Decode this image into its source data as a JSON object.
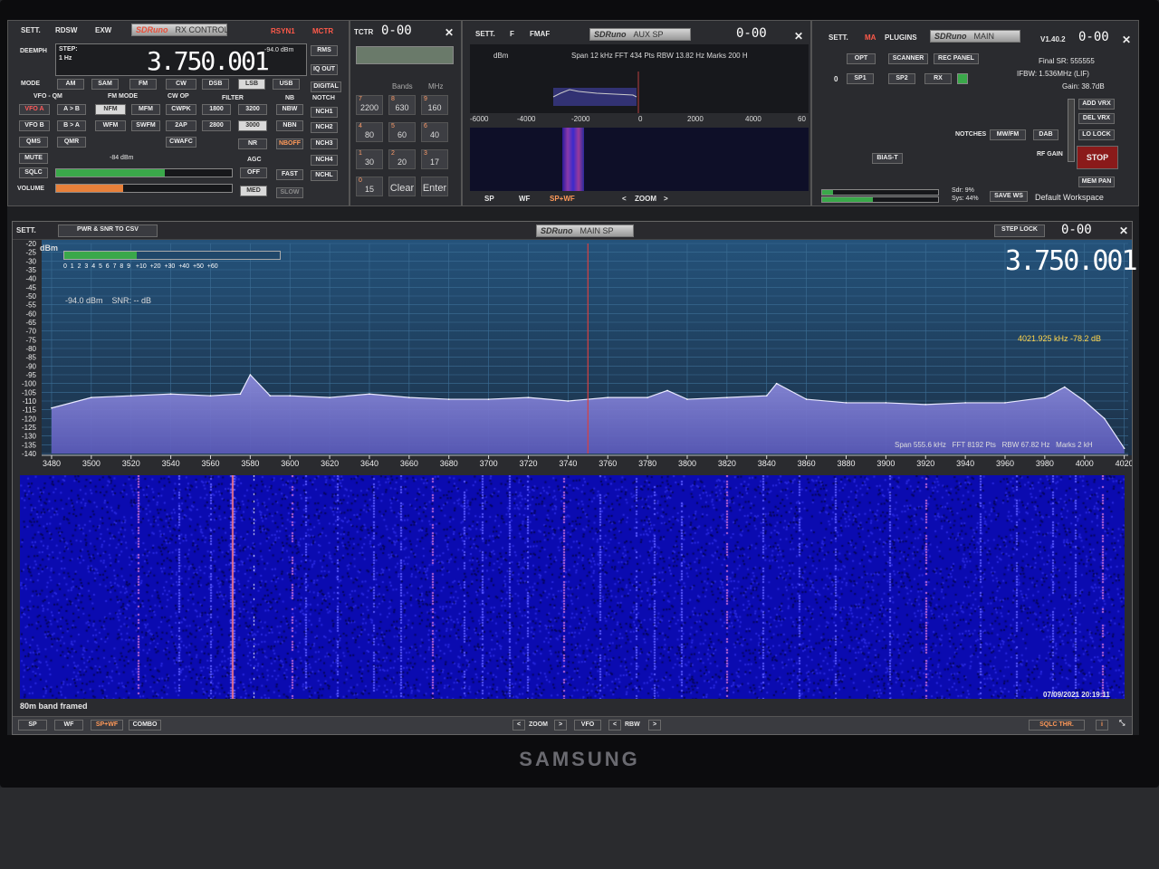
{
  "rx_control": {
    "sett": "SETT.",
    "rdsw": "RDSW",
    "exw": "EXW",
    "logo": "SDRuno",
    "subtitle": "RX CONTROL",
    "rsyn1": "RSYN1",
    "mctr": "MCTR",
    "deemph": "DEEMPH",
    "step_label": "STEP:",
    "step_value": "1 Hz",
    "frequency": "3.750.001",
    "dbm": "-94.0 dBm",
    "right_buttons": [
      "RMS",
      "IQ OUT",
      "DIGITAL"
    ],
    "mode_label": "MODE",
    "modes": [
      "AM",
      "SAM",
      "FM",
      "CW",
      "DSB",
      "LSB",
      "USB"
    ],
    "vfo_qm": "VFO - QM",
    "fm_mode": "FM MODE",
    "cw_op": "CW OP",
    "filter": "FILTER",
    "nb": "NB",
    "notch": "NOTCH",
    "vfo_a": "VFO A",
    "a_to_b": "A > B",
    "nfm": "NFM",
    "mfm": "MFM",
    "cwpk": "CWPK",
    "f1800": "1800",
    "f3200": "3200",
    "nbw": "NBW",
    "nch1": "NCH1",
    "vfo_b": "VFO B",
    "b_to_a": "B > A",
    "wfm": "WFM",
    "swfm": "SWFM",
    "twoap": "2AP",
    "f2800": "2800",
    "f3000": "3000",
    "nbn": "NBN",
    "nch2": "NCH2",
    "qms": "QMS",
    "qmr": "QMR",
    "cwafc": "CWAFC",
    "nr": "NR",
    "nboff": "NBOFF",
    "nch3": "NCH3",
    "nch4": "NCH4",
    "nchl": "NCHL",
    "mute": "MUTE",
    "sqlc": "SQLC",
    "volume": "VOLUME",
    "squelch_dbm": "-84 dBm",
    "agc": "AGC",
    "agc_off": "OFF",
    "agc_fast": "FAST",
    "agc_med": "MED",
    "agc_slow": "SLOW",
    "squelch_level": 0.62,
    "volume_level": 0.38
  },
  "tctr": {
    "label": "TCTR",
    "display": "0-00",
    "bands": "Bands",
    "mhz": "MHz",
    "keys": [
      {
        "n": "7",
        "v": "2200"
      },
      {
        "n": "8",
        "v": "630"
      },
      {
        "n": "9",
        "v": "160"
      },
      {
        "n": "4",
        "v": "80"
      },
      {
        "n": "5",
        "v": "60"
      },
      {
        "n": "6",
        "v": "40"
      },
      {
        "n": "1",
        "v": "30"
      },
      {
        "n": "2",
        "v": "20"
      },
      {
        "n": "3",
        "v": "17"
      },
      {
        "n": "0",
        "v": "15"
      }
    ],
    "clear": "Clear",
    "enter": "Enter"
  },
  "aux_sp": {
    "sett": "SETT.",
    "f": "F",
    "fmaf": "FMAF",
    "logo": "SDRuno",
    "subtitle": "AUX SP",
    "display": "0-00",
    "dbm": "dBm",
    "info": "Span 12 kHz  FFT 434 Pts  RBW 13.82 Hz  Marks 200 H",
    "ticks": [
      "-6000",
      "-4000",
      "-2000",
      "0",
      "2000",
      "4000",
      "60"
    ],
    "sp": "SP",
    "wf": "WF",
    "spwf": "SP+WF",
    "zoom": "ZOOM"
  },
  "main": {
    "sett": "SETT.",
    "ma": "MA",
    "plugins": "PLUGINS",
    "logo": "SDRuno",
    "subtitle": "MAIN",
    "version": "V1.40.2",
    "display": "0-00",
    "opt": "OPT",
    "scanner": "SCANNER",
    "rec_panel": "REC PANEL",
    "zero": "0",
    "sp1": "SP1",
    "sp2": "SP2",
    "rx": "RX",
    "final_sr": "Final SR: 555555",
    "ifbw": "IFBW: 1.536MHz (LIF)",
    "gain": "Gain: 38.7dB",
    "add_vrx": "ADD VRX",
    "del_vrx": "DEL VRX",
    "lo_lock": "LO LOCK",
    "stop": "STOP",
    "mem_pan": "MEM PAN",
    "notches": "NOTCHES",
    "mwfm": "MW/FM",
    "dab": "DAB",
    "rf_gain": "RF GAIN",
    "bias_t": "BIAS-T",
    "sdr": "Sdr: 9%",
    "sys": "Sys: 44%",
    "save_ws": "SAVE WS",
    "workspace": "Default Workspace",
    "sdr_load": 0.09,
    "sys_load": 0.44
  },
  "main_sp": {
    "sett": "SETT.",
    "pwr_csv": "PWR & SNR TO CSV",
    "logo": "SDRuno",
    "subtitle": "MAIN SP",
    "step_lock": "STEP LOCK",
    "display": "0-00",
    "frequency": "3.750.001",
    "dbm_axis": "dBm",
    "y_ticks": [
      "-20",
      "-25",
      "-30",
      "-35",
      "-40",
      "-45",
      "-50",
      "-55",
      "-60",
      "-65",
      "-70",
      "-75",
      "-80",
      "-85",
      "-90",
      "-95",
      "-100",
      "-105",
      "-110",
      "-115",
      "-120",
      "-125",
      "-130",
      "-135",
      "-140"
    ],
    "s_scale": [
      "1",
      "2",
      "3",
      "4",
      "5",
      "6",
      "7",
      "8",
      "9",
      "+10",
      "+20",
      "+30",
      "+40",
      "+50",
      "+60"
    ],
    "s_zero": "0",
    "snr_text": "-94.0 dBm    SNR: -- dB",
    "cursor": "4021.925 kHz -78.2 dB",
    "info": "Span 555.6 kHz   FFT 8192 Pts   RBW 67.82 Hz   Marks 2 kH",
    "x_ticks": [
      "3480",
      "3500",
      "3520",
      "3540",
      "3560",
      "3580",
      "3600",
      "3620",
      "3640",
      "3660",
      "3680",
      "3700",
      "3720",
      "3740",
      "3760",
      "3780",
      "3800",
      "3820",
      "3840",
      "3860",
      "3880",
      "3900",
      "3920",
      "3940",
      "3960",
      "3980",
      "4000",
      "4020"
    ],
    "tuned_khz": 3750.001,
    "caption": "80m band framed",
    "timestamp": "07/09/2021 20:19:11",
    "sp": "SP",
    "wf": "WF",
    "spwf": "SP+WF",
    "combo": "COMBO",
    "zoom": "ZOOM",
    "vfo": "VFO",
    "rbw": "RBW",
    "sqlc_thr": "SQLC THR.",
    "i": "i"
  },
  "monitor": {
    "brand": "SAMSUNG"
  },
  "chart_data": {
    "type": "area",
    "title": "",
    "xlabel": "kHz",
    "ylabel": "dBm",
    "xlim": [
      3475,
      4022
    ],
    "ylim": [
      -140,
      -20
    ],
    "x": [
      3480,
      3500,
      3520,
      3540,
      3560,
      3575,
      3580,
      3590,
      3600,
      3620,
      3640,
      3660,
      3680,
      3700,
      3720,
      3740,
      3750,
      3760,
      3780,
      3790,
      3800,
      3820,
      3840,
      3845,
      3860,
      3880,
      3900,
      3920,
      3940,
      3960,
      3980,
      3990,
      4000,
      4010,
      4020
    ],
    "values": [
      -114,
      -108,
      -107,
      -106,
      -107,
      -106,
      -95,
      -107,
      -107,
      -108,
      -106,
      -108,
      -109,
      -109,
      -108,
      -110,
      -109,
      -108,
      -108,
      -104,
      -109,
      -108,
      -107,
      -100,
      -109,
      -111,
      -111,
      -112,
      -111,
      -111,
      -108,
      -102,
      -110,
      -120,
      -137
    ]
  }
}
